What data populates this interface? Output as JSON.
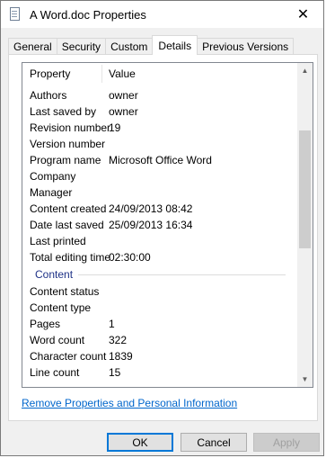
{
  "window": {
    "title": "A Word.doc Properties",
    "close_glyph": "✕"
  },
  "tabs": [
    {
      "label": "General"
    },
    {
      "label": "Security"
    },
    {
      "label": "Custom"
    },
    {
      "label": "Details",
      "active": true
    },
    {
      "label": "Previous Versions"
    }
  ],
  "list": {
    "header": {
      "property": "Property",
      "value": "Value"
    },
    "rows": [
      {
        "type": "row",
        "property": "Authors",
        "value": "owner"
      },
      {
        "type": "row",
        "property": "Last saved by",
        "value": "owner"
      },
      {
        "type": "row",
        "property": "Revision number",
        "value": "19"
      },
      {
        "type": "row",
        "property": "Version number",
        "value": ""
      },
      {
        "type": "row",
        "property": "Program name",
        "value": "Microsoft Office Word"
      },
      {
        "type": "row",
        "property": "Company",
        "value": ""
      },
      {
        "type": "row",
        "property": "Manager",
        "value": ""
      },
      {
        "type": "row",
        "property": "Content created",
        "value": "24/09/2013 08:42"
      },
      {
        "type": "row",
        "property": "Date last saved",
        "value": "25/09/2013 16:34"
      },
      {
        "type": "row",
        "property": "Last printed",
        "value": ""
      },
      {
        "type": "row",
        "property": "Total editing time",
        "value": "02:30:00"
      },
      {
        "type": "group",
        "label": "Content"
      },
      {
        "type": "row",
        "property": "Content status",
        "value": ""
      },
      {
        "type": "row",
        "property": "Content type",
        "value": ""
      },
      {
        "type": "row",
        "property": "Pages",
        "value": "1"
      },
      {
        "type": "row",
        "property": "Word count",
        "value": "322"
      },
      {
        "type": "row",
        "property": "Character count",
        "value": "1839"
      },
      {
        "type": "row",
        "property": "Line count",
        "value": "15"
      }
    ]
  },
  "scrollbar": {
    "up_glyph": "▲",
    "down_glyph": "▼"
  },
  "link": {
    "label": "Remove Properties and Personal Information"
  },
  "buttons": {
    "ok": "OK",
    "cancel": "Cancel",
    "apply": "Apply"
  },
  "colors": {
    "link": "#0066cc",
    "group_header": "#1e3287",
    "ok_border": "#0078d7"
  }
}
